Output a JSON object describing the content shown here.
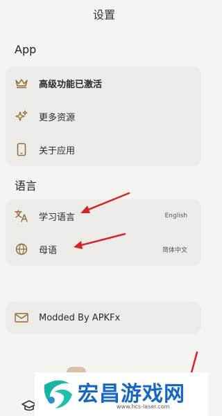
{
  "header": {
    "title": "设置"
  },
  "sections": {
    "app_title": "App",
    "language_title": "语言"
  },
  "app_items": [
    {
      "label": "高级功能已激活",
      "icon": "crown-icon"
    },
    {
      "label": "更多资源",
      "icon": "sparkles-icon"
    },
    {
      "label": "关于应用",
      "icon": "phone-icon"
    }
  ],
  "language_items": [
    {
      "label": "学习语言",
      "value": "English",
      "icon": "translate-icon"
    },
    {
      "label": "母语",
      "value": "简体中文",
      "icon": "globe-icon"
    }
  ],
  "extra_item": {
    "label": "Modded By APKFx",
    "icon": "mail-icon"
  },
  "watermark": {
    "text": "宏昌游戏网",
    "url": "www.hcs-laser.com"
  },
  "colors": {
    "accent": "#8a6d3b",
    "arrow": "#d0262a",
    "card": "#ecebe7",
    "background": "#f6f4f0",
    "watermark": "#1667c4"
  }
}
